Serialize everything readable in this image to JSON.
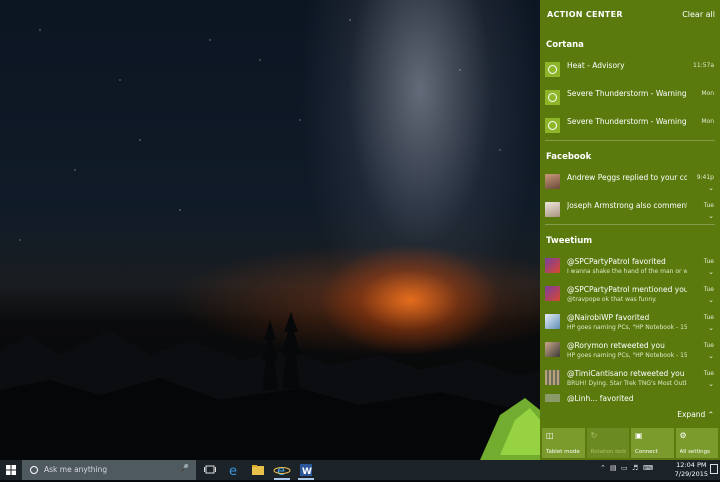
{
  "action_center": {
    "title": "ACTION CENTER",
    "clear_all": "Clear all",
    "expand": "Expand",
    "groups": [
      {
        "name": "Cortana",
        "items": [
          {
            "title": "Heat - Advisory",
            "body": "",
            "time": "11:57a"
          },
          {
            "title": "Severe Thunderstorm - Warning",
            "body": "",
            "time": "Mon"
          },
          {
            "title": "Severe Thunderstorm - Warning",
            "body": "",
            "time": "Mon"
          }
        ]
      },
      {
        "name": "Facebook",
        "items": [
          {
            "title": "Andrew Peggs replied to your comr",
            "body": "",
            "time": "9:41p"
          },
          {
            "title": "Joseph Armstrong also commented",
            "body": "",
            "time": "Tue"
          }
        ]
      },
      {
        "name": "Tweetium",
        "items": [
          {
            "title": "@SPCPartyPatrol favorited",
            "body": "I wanna shake the hand of the man or wc",
            "time": "Tue"
          },
          {
            "title": "@SPCPartyPatrol mentioned you",
            "body": "@travpope ok that was funny.",
            "time": "Tue"
          },
          {
            "title": "@NairobiWP favorited",
            "body": "HP goes naming PCs, \"HP Notebook - 15",
            "time": "Tue"
          },
          {
            "title": "@Rorymon retweeted you",
            "body": "HP goes naming PCs, \"HP Notebook - 15",
            "time": "Tue"
          },
          {
            "title": "@TimiCantisano retweeted you",
            "body": "BRUH! Dying. Star Trek TNG's Most Outla",
            "time": "Tue"
          },
          {
            "title": "@Linh... favorited",
            "body": "",
            "time": ""
          }
        ]
      }
    ],
    "quick_actions": [
      {
        "label": "Tablet mode",
        "icon": "tablet-mode-icon",
        "enabled": true
      },
      {
        "label": "Rotation lock",
        "icon": "rotation-lock-icon",
        "enabled": false
      },
      {
        "label": "Connect",
        "icon": "connect-icon",
        "enabled": true
      },
      {
        "label": "All settings",
        "icon": "gear-icon",
        "enabled": true
      }
    ]
  },
  "taskbar": {
    "search_placeholder": "Ask me anything",
    "clock_time": "12:04 PM",
    "clock_date": "7/29/2015"
  },
  "colors": {
    "action_center_bg": "#5a7a0e",
    "accent": "#8db62a",
    "taskbar_bg": "#1b2329"
  }
}
